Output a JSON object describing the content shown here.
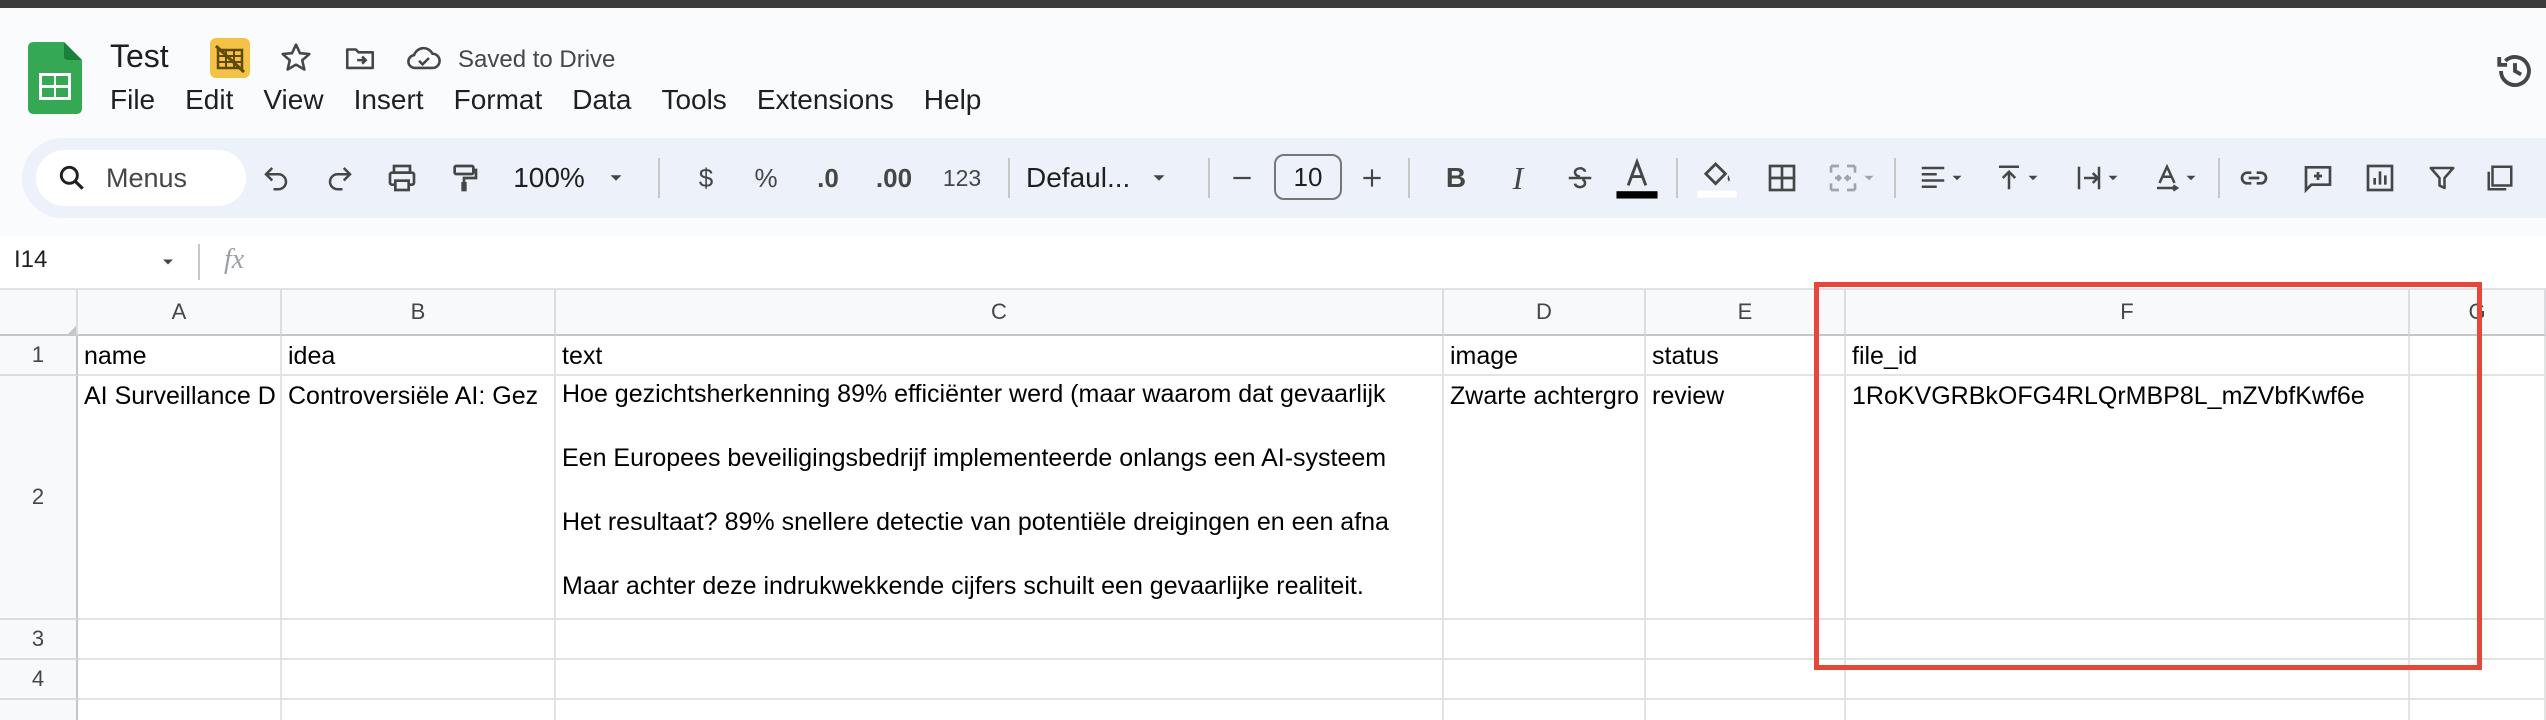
{
  "app": {
    "doc_title": "Test",
    "saved_status": "Saved to Drive",
    "menus": [
      "File",
      "Edit",
      "View",
      "Insert",
      "Format",
      "Data",
      "Tools",
      "Extensions",
      "Help"
    ]
  },
  "toolbar": {
    "search_label": "Menus",
    "zoom": "100%",
    "currency": "$",
    "percent": "%",
    "decrease_decimal": ".0",
    "increase_decimal": ".00",
    "number_format": "123",
    "font": "Defaul...",
    "font_size": "10",
    "bold": "B",
    "italic": "I"
  },
  "formula_bar": {
    "cell_ref": "I14",
    "fx": "fx",
    "value": ""
  },
  "columns": [
    "A",
    "B",
    "C",
    "D",
    "E",
    "F",
    "G"
  ],
  "rows": [
    "1",
    "2",
    "3",
    "4"
  ],
  "sheet": {
    "headers": [
      "name",
      "idea",
      "text",
      "image",
      "status",
      "file_id"
    ],
    "row2": {
      "name": "AI Surveillance D",
      "idea": "Controversiële AI: Gez",
      "text_lines": [
        "Hoe gezichtsherkenning 89% efficiënter werd (maar waarom dat gevaarlijk",
        "Een Europees beveiligingsbedrijf implementeerde onlangs een AI-systeem",
        "Het resultaat? 89% snellere detectie van potentiële dreigingen en een afna",
        "Maar achter deze indrukwekkende cijfers schuilt een gevaarlijke realiteit."
      ],
      "image": "Zwarte achtergro",
      "status": "review",
      "file_id": "1RoKVGRBkOFG4RLQrMBP8L_mZVbfKwf6e"
    }
  },
  "colors": {
    "highlight": "#e5483b",
    "sheets_green": "#34a853",
    "toolbar_bg": "#edf2fa"
  },
  "icons": [
    "sheets-logo-icon",
    "offline-badge-icon",
    "star-icon",
    "move-folder-icon",
    "cloud-check-icon",
    "history-icon",
    "search-icon",
    "undo-icon",
    "redo-icon",
    "print-icon",
    "paint-format-icon"
  ]
}
